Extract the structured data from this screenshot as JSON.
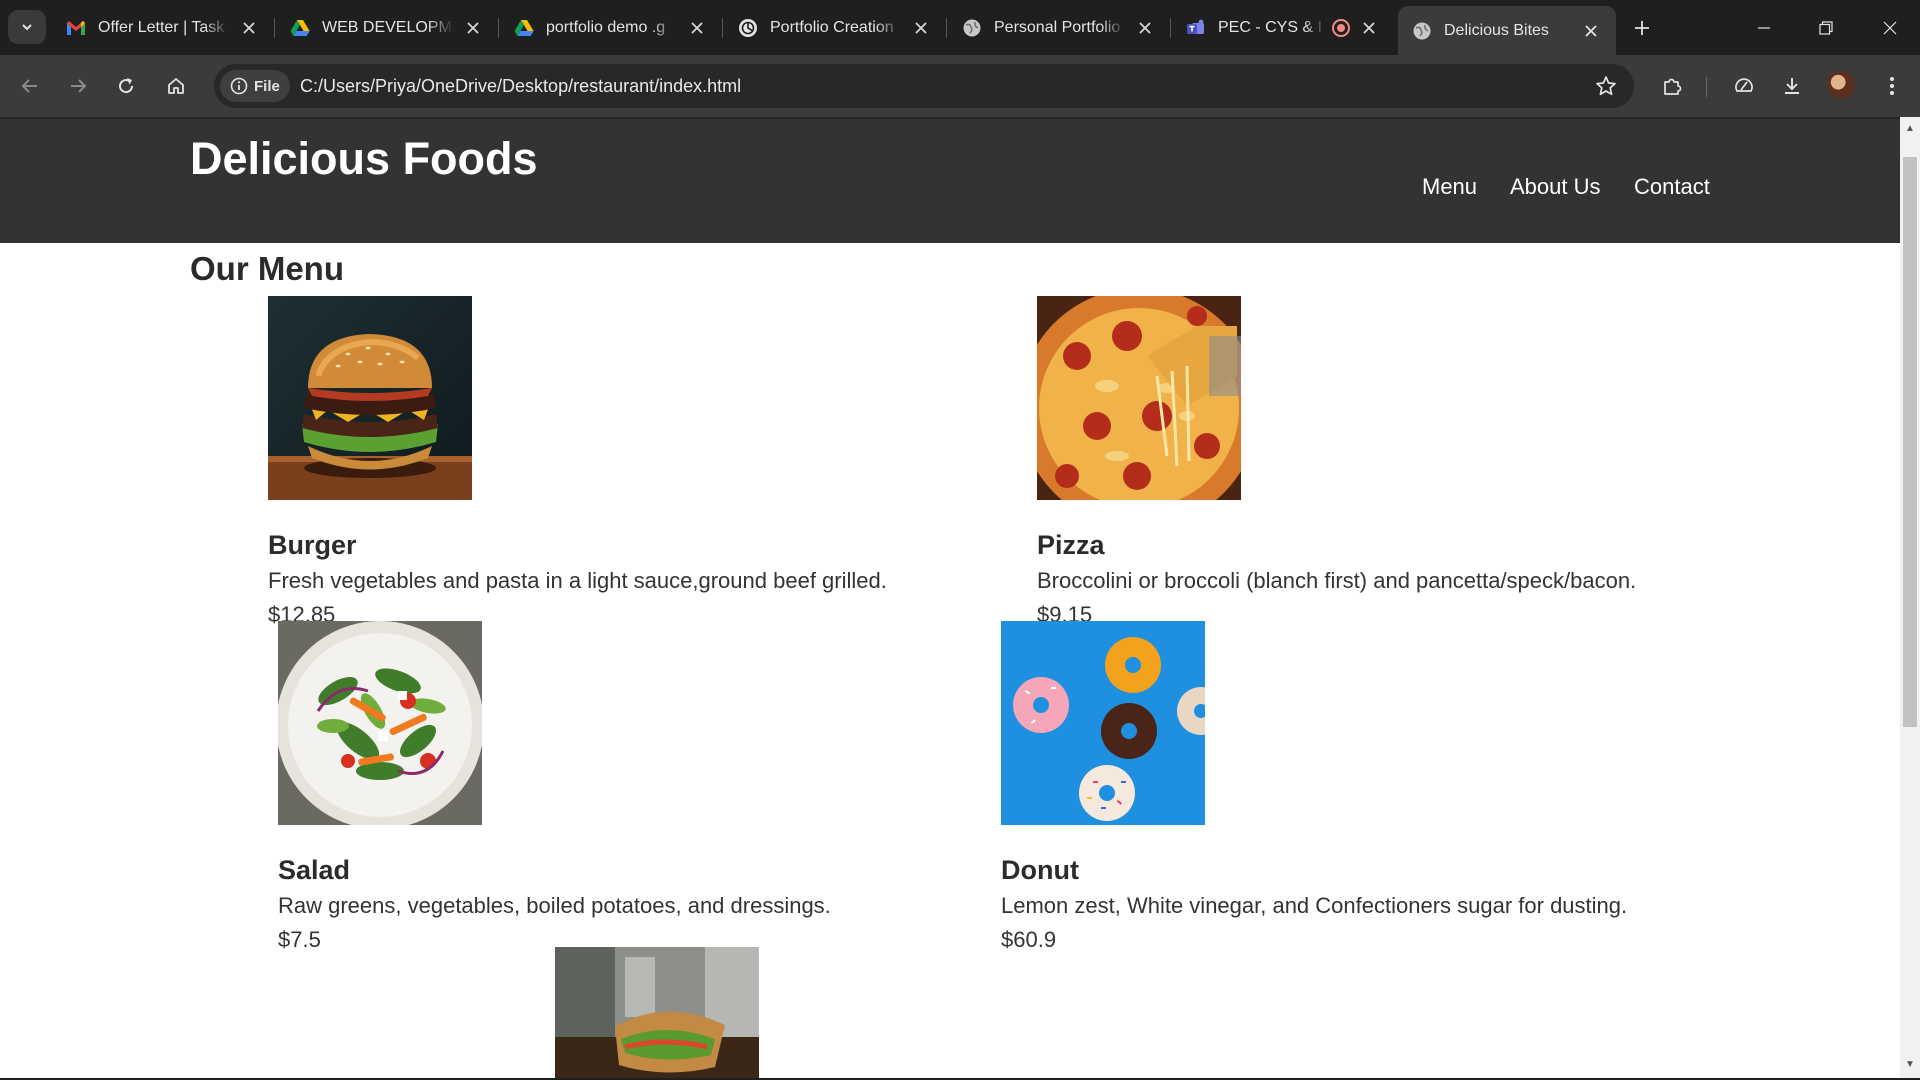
{
  "browser": {
    "tabs": [
      {
        "title": "Offer Letter | Task",
        "favicon": "gmail-icon",
        "active": false
      },
      {
        "title": "WEB DEVELOPME",
        "favicon": "drive-icon",
        "active": false
      },
      {
        "title": "portfolio demo .g",
        "favicon": "drive-icon",
        "active": false
      },
      {
        "title": "Portfolio Creation",
        "favicon": "chatgpt-icon",
        "active": false
      },
      {
        "title": "Personal Portfolio",
        "favicon": "globe-icon",
        "active": false
      },
      {
        "title": "PEC - CYS & I",
        "favicon": "teams-icon",
        "active": false
      },
      {
        "title": "Delicious Bites",
        "favicon": "globe-icon",
        "active": true
      }
    ],
    "address": {
      "chip_label": "File",
      "url": "C:/Users/Priya/OneDrive/Desktop/restaurant/index.html"
    }
  },
  "site": {
    "title": "Delicious Foods",
    "nav": [
      "Menu",
      "About Us",
      "Contact"
    ],
    "menu_heading": "Our Menu",
    "items": [
      {
        "name": "Burger",
        "description": "Fresh vegetables and pasta in a light sauce,ground beef grilled.",
        "price": "$12.85",
        "image": "burger-photo"
      },
      {
        "name": "Pizza",
        "description": "Broccolini or broccoli (blanch first) and pancetta/speck/bacon.",
        "price": "$9.15",
        "image": "pizza-photo"
      },
      {
        "name": "Salad",
        "description": "Raw greens, vegetables, boiled potatoes, and dressings.",
        "price": "$7.5",
        "image": "salad-photo"
      },
      {
        "name": "Donut",
        "description": "Lemon zest, White vinegar, and Confectioners sugar for dusting.",
        "price": "$60.9",
        "image": "donut-photo"
      },
      {
        "image": "sandwich-photo"
      }
    ]
  },
  "colors": {
    "tabstrip": "#1f1f1f",
    "toolbar": "#3b3b3b",
    "site_header": "#333333",
    "page_bg": "#ffffff",
    "text": "#2b2b2b"
  }
}
